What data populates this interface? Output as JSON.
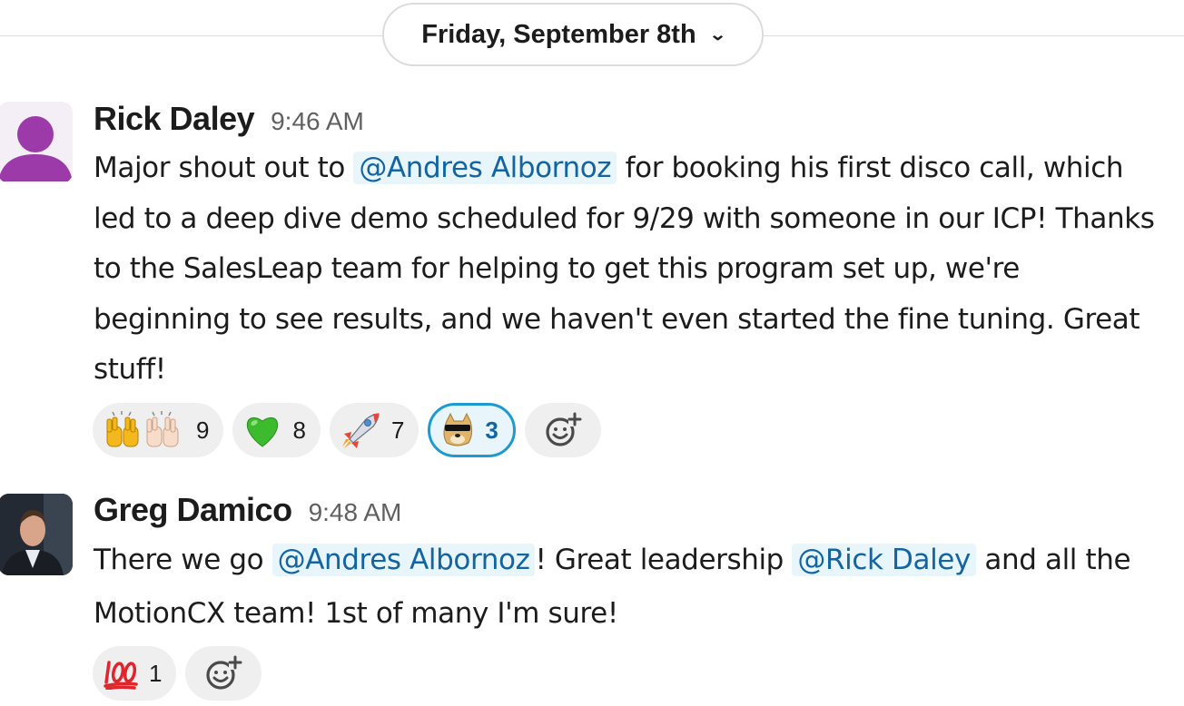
{
  "date_divider": {
    "label": "Friday, September 8th",
    "chevron": "chevron-down-icon"
  },
  "messages": [
    {
      "author": "Rick Daley",
      "time": "9:46 AM",
      "avatar": "default-person-avatar",
      "text_parts": {
        "p1": "Major shout out to ",
        "m1": "@Andres Albornoz",
        "p2": " for booking his first disco call, which led to a deep dive demo scheduled for 9/29 with someone in our ICP!  Thanks to the SalesLeap team for helping to get this program set up, we're beginning to see results, and we haven't even started the fine tuning.  Great stuff!"
      },
      "reactions": [
        {
          "emoji": "raising-hands-emoji",
          "count": "9"
        },
        {
          "emoji": "green-heart-emoji",
          "count": "8"
        },
        {
          "emoji": "rocket-emoji",
          "count": "7"
        },
        {
          "emoji": "doge-sunglasses-emoji",
          "count": "3",
          "selected": true
        }
      ],
      "add_reaction_icon": "add-reaction-icon"
    },
    {
      "author": "Greg Damico",
      "time": "9:48 AM",
      "avatar": "profile-photo-avatar",
      "text_parts": {
        "p1": "There we go ",
        "m1": "@Andres Albornoz",
        "p2": "! Great leadership ",
        "m2": "@Rick Daley",
        "p3": " and all the MotionCX team! 1st of many I'm sure!"
      },
      "reactions": [
        {
          "emoji": "hundred-points-emoji",
          "count": "1"
        }
      ],
      "add_reaction_icon": "add-reaction-icon"
    }
  ],
  "colors": {
    "mention_bg": "#e8f5fa",
    "mention_text": "#1264a3",
    "selected_reaction_border": "#1d9bd1",
    "avatar_purple": "#9b3aa8"
  }
}
